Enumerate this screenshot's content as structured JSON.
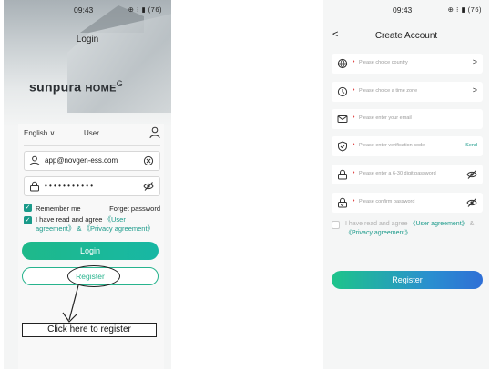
{
  "login_screen": {
    "status_time": "09:43",
    "status_icons": "⊕ ⁝ ▮ (76)",
    "title": "Login",
    "brand_main": "sunpura",
    "brand_home": "HOME",
    "brand_mark": "G",
    "language": "English",
    "language_caret": "∨",
    "user_label": "User",
    "account_value": "app@novgen-ess.com",
    "password_value": "• • • • • • • • • • •",
    "remember_label": "Remember me",
    "forget_label": "Forget password",
    "agree_prefix": "I have read and agree ",
    "user_agreement": "《User agreement》",
    "and": " & ",
    "privacy_agreement": "《Privacy agreement》",
    "login_button": "Login",
    "register_button": "Register",
    "annotation": "Click here to register",
    "check_mark": "✓"
  },
  "register_screen": {
    "status_time": "09:43",
    "status_icons": "⊕ ⁝ ▮ (76)",
    "back": "<",
    "title": "Create Account",
    "required_mark": "•",
    "fields": [
      {
        "placeholder": "Please choice country",
        "right": ">"
      },
      {
        "placeholder": "Please choice a time zone",
        "right": ">"
      },
      {
        "placeholder": "Please enter your email"
      },
      {
        "placeholder": "Please enter verification code",
        "right": "Send"
      },
      {
        "placeholder": "Please enter a 6-30 digit password"
      },
      {
        "placeholder": "Please confirm password"
      }
    ],
    "agree_prefix": "I have read and agree ",
    "user_agreement": "《User agreement》",
    "and": " & ",
    "privacy_agreement": "《Privacy agreement》",
    "register_button": "Register"
  },
  "colors": {
    "accent": "#1a9a8a",
    "required": "#e04848"
  }
}
